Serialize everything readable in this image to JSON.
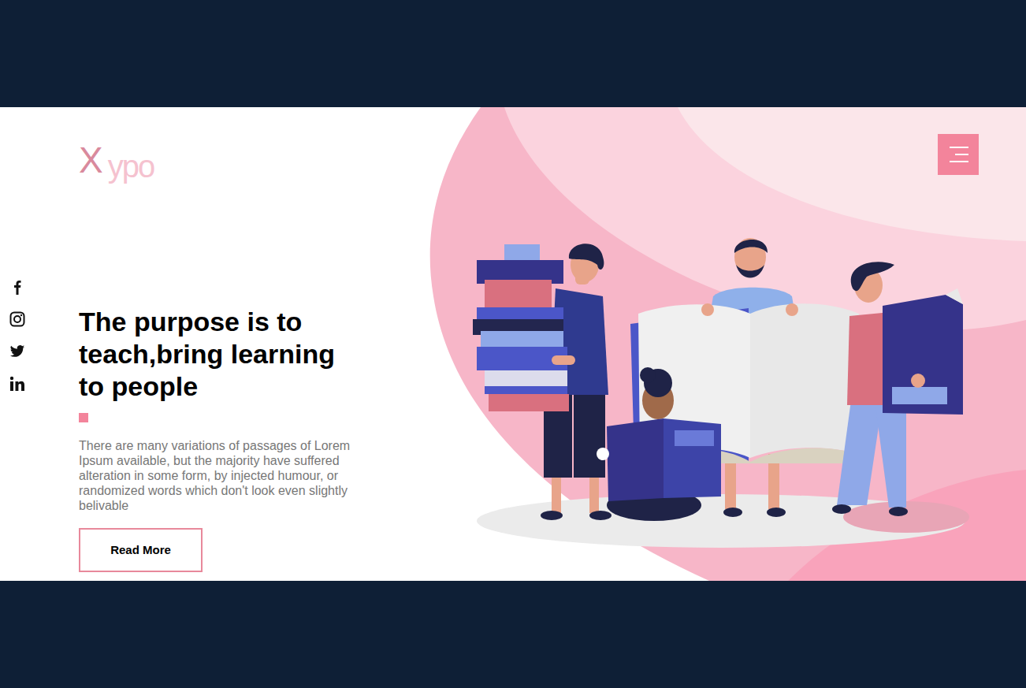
{
  "logo": {
    "initial": "X",
    "rest": "ypo"
  },
  "hero": {
    "title": "The purpose is to teach,bring learning to people",
    "description": "There are many variations of passages of Lorem Ipsum available, but the majority have suffered alteration in some form, by injected humour, or randomized words which don't look even slightly belivable",
    "button": "Read More"
  }
}
